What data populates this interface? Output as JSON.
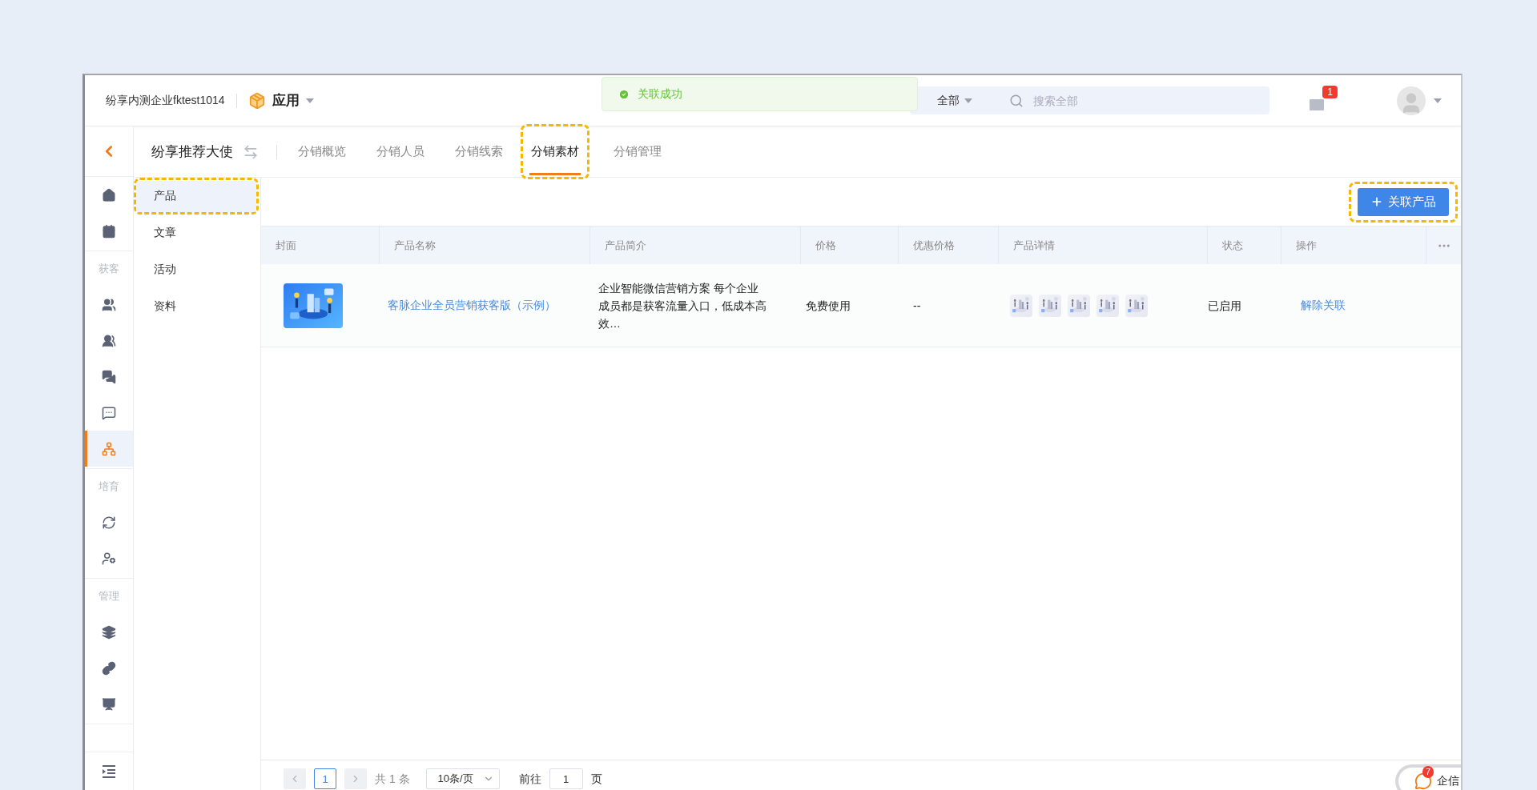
{
  "header": {
    "company": "纷享内测企业fktest1014",
    "app_menu": "应用",
    "search": {
      "scope": "全部",
      "placeholder": "搜索全部"
    },
    "mail_badge": "1"
  },
  "toast": {
    "message": "关联成功"
  },
  "sidebar": {
    "sections": [
      {
        "items": [
          {
            "selected": false
          },
          {
            "selected": false
          }
        ]
      },
      {
        "label": "获客",
        "items": [
          {
            "selected": false
          },
          {
            "selected": false
          },
          {
            "selected": false
          },
          {
            "selected": false
          },
          {
            "selected": true
          }
        ]
      },
      {
        "label": "培育",
        "items": [
          {
            "selected": false
          },
          {
            "selected": false
          }
        ]
      },
      {
        "label": "管理",
        "items": [
          {
            "selected": false
          },
          {
            "selected": false
          },
          {
            "selected": false
          }
        ]
      }
    ]
  },
  "app_title": "纷享推荐大使",
  "tabs": [
    {
      "label": "分销概览",
      "selected": false,
      "highlighted": false
    },
    {
      "label": "分销人员",
      "selected": false,
      "highlighted": false
    },
    {
      "label": "分销线索",
      "selected": false,
      "highlighted": false
    },
    {
      "label": "分销素材",
      "selected": true,
      "highlighted": true
    },
    {
      "label": "分销管理",
      "selected": false,
      "highlighted": false
    }
  ],
  "submenu": [
    {
      "label": "产品",
      "selected": true,
      "highlighted": true
    },
    {
      "label": "文章",
      "selected": false,
      "highlighted": false
    },
    {
      "label": "活动",
      "selected": false,
      "highlighted": false
    },
    {
      "label": "资料",
      "selected": false,
      "highlighted": false
    }
  ],
  "add_button": {
    "label": "关联产品",
    "highlighted": true
  },
  "table": {
    "columns": [
      "封面",
      "产品名称",
      "产品简介",
      "价格",
      "优惠价格",
      "产品详情",
      "状态",
      "操作"
    ],
    "rows": [
      {
        "name": "客脉企业全员营销获客版（示例）",
        "description": "企业智能微信营销方案 每个企业成员都是获客流量入口，低成本高效…",
        "price": "免费使用",
        "discount_price": "--",
        "status": "已启用",
        "action": "解除关联"
      }
    ]
  },
  "pagination": {
    "page": "1",
    "total": "共 1 条",
    "page_size": "10条/页",
    "goto_label": "前往",
    "goto_value": "1",
    "page_suffix": "页"
  },
  "chat_widget": {
    "label": "企信",
    "badge": "7"
  }
}
